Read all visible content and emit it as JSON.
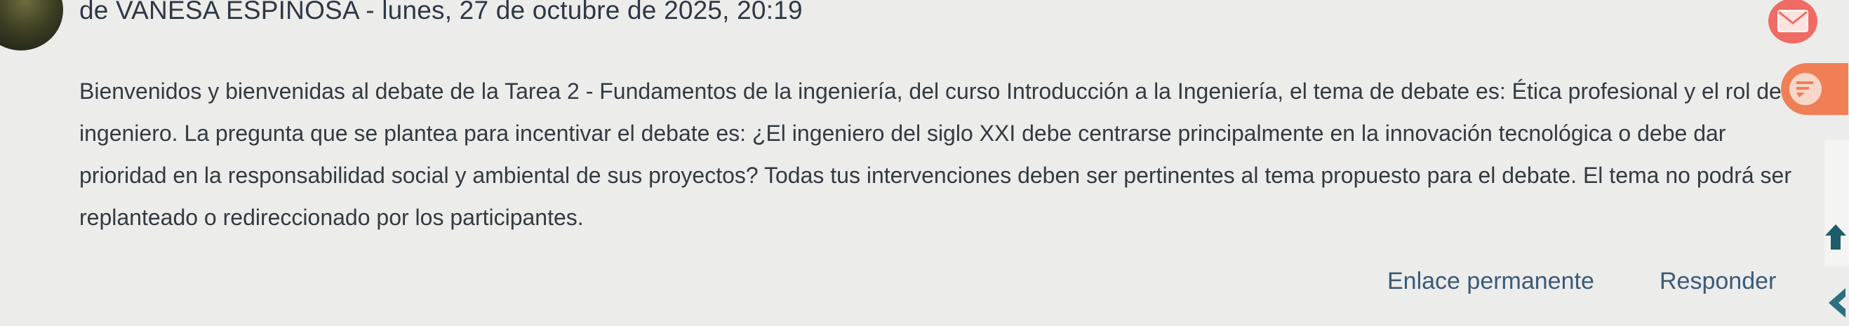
{
  "post": {
    "byline": "de VANESA ESPINOSA - lunes, 27 de octubre de 2025, 20:19",
    "paragraphs": [
      "Bienvenidos y bienvenidas al debate de la Tarea 2 - Fundamentos de la ingeniería, del curso Introducción a la Ingeniería, el tema de debate es: Ética profesional y el rol del ingeniero. La pregunta que se plantea para incentivar el debate es: ¿El ingeniero del siglo XXI debe centrarse principalmente en la innovación tecnológica o debe dar prioridad en la responsabilidad social y ambiental de sus proyectos? Todas tus intervenciones deben ser pertinentes al tema propuesto para el debate. El tema no podrá ser replanteado o redireccionado por los participantes."
    ],
    "actions": {
      "permalink": "Enlace permanente",
      "reply": "Responder"
    }
  },
  "side_icons": {
    "messages": "mail-icon",
    "chat": "chat-icon",
    "scroll_top": "arrow-up-icon",
    "drawer": "arrow-left-icon"
  },
  "colors": {
    "background": "#ececeb",
    "link": "#3a5a78",
    "mail_button": "#ef6b63",
    "chat_button": "#f07f56"
  }
}
